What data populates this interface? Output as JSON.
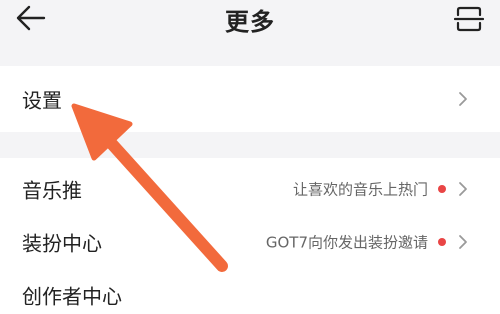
{
  "header": {
    "back_icon": "arrow-left-icon",
    "title": "更多",
    "scan_icon": "scan-icon"
  },
  "settings": {
    "label": "设置",
    "icon": "chevron-right-icon"
  },
  "menu": {
    "items": [
      {
        "label": "音乐推",
        "subtitle": "让喜欢的音乐上热门",
        "has_dot": true
      },
      {
        "label": "装扮中心",
        "subtitle": "GOT7向你发出装扮邀请",
        "has_dot": true
      },
      {
        "label": "创作者中心",
        "subtitle": "",
        "has_dot": false
      }
    ]
  },
  "annotation": {
    "arrow_color": "#f26a3c",
    "points_to": "设置"
  },
  "colors": {
    "background": "#f4f4f6",
    "card": "#ffffff",
    "dot": "#e94545",
    "text": "#222222",
    "subtext": "#666666"
  }
}
